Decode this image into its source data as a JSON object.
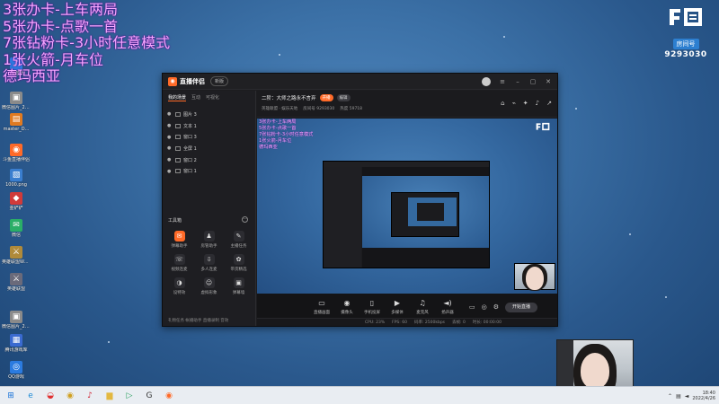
{
  "overlay": {
    "lines": [
      "3张办卡-上车两局",
      "5张办卡-点歌一首",
      "7张钻粉卡-3小时任意模式",
      "1张火箭-月车位",
      "德玛西亚"
    ]
  },
  "douyu": {
    "room_label": "房间号",
    "room_id": "9293030"
  },
  "desktop_icons": [
    {
      "label": "QQ音乐",
      "color": "#2b7be0",
      "glyph": "♪"
    },
    {
      "label": "微信图片_20220412...",
      "color": "#8a8a8a",
      "glyph": "▣"
    },
    {
      "label": "master_D...",
      "color": "#e07a20",
      "glyph": "▤"
    },
    {
      "label": "斗鱼直播伴侣",
      "color": "#ff6a28",
      "glyph": "◉"
    },
    {
      "label": "1000.png",
      "color": "#3a7ecf",
      "glyph": "▧"
    },
    {
      "label": "金铲铲",
      "color": "#d03a3a",
      "glyph": "◆"
    },
    {
      "label": "微信",
      "color": "#2aae67",
      "glyph": "✉"
    },
    {
      "label": "英雄联盟WeGame版",
      "color": "#b08a3a",
      "glyph": "⚔"
    },
    {
      "label": "英雄联盟",
      "color": "#6a6a7a",
      "glyph": "⚔"
    },
    {
      "label": "微信图片_20220413...",
      "color": "#8a8a8a",
      "glyph": "▣"
    },
    {
      "label": "腾讯游戏库",
      "color": "#3a6ad0",
      "glyph": "▦"
    },
    {
      "label": "QQ游戏",
      "color": "#2b7be0",
      "glyph": "◎"
    }
  ],
  "app": {
    "brand": "直播伴侣",
    "version": "新版",
    "sidebar_tabs": [
      "我的场景",
      "互动",
      "可视化"
    ],
    "scenes": [
      {
        "label": "图片 3"
      },
      {
        "label": "文本 1"
      },
      {
        "label": "窗口 3"
      },
      {
        "label": "全屏 1"
      },
      {
        "label": "窗口 2"
      },
      {
        "label": "窗口 1"
      }
    ],
    "tools_title": "工具箱",
    "tools": [
      {
        "label": "弹幕助手",
        "glyph": "✉",
        "hot": true
      },
      {
        "label": "房管助手",
        "glyph": "♟",
        "hot": false
      },
      {
        "label": "主播任务",
        "glyph": "✎",
        "hot": false
      },
      {
        "label": "视频连麦",
        "glyph": "☏",
        "hot": false
      },
      {
        "label": "多人连麦",
        "glyph": "⇩",
        "hot": false
      },
      {
        "label": "带货精选",
        "glyph": "✿",
        "hot": false
      },
      {
        "label": "设特效",
        "glyph": "◑",
        "hot": false
      },
      {
        "label": "虚拟形象",
        "glyph": "☺",
        "hot": false
      },
      {
        "label": "弹幕墙",
        "glyph": "▣",
        "hot": false
      }
    ],
    "status_left": "礼物任务   帐播助手    直播录制    音效",
    "room_title": "二阶：大师之路永不言弃",
    "pill_orange": "开播",
    "pill_gray": "编辑",
    "sub_info": [
      "英雄联盟 · 娱乐天地",
      "房间号 9293030",
      "热度 59718"
    ],
    "preview_lines": [
      "3张办卡-上车两局",
      "5张办卡-点歌一首",
      "7张钻粉卡-3小时任意模式",
      "1张火箭-月车位",
      "德玛西亚"
    ],
    "controls": [
      {
        "label": "直播画面",
        "glyph": "▭"
      },
      {
        "label": "摄像头",
        "glyph": "◉"
      },
      {
        "label": "手机投屏",
        "glyph": "▯"
      },
      {
        "label": "多媒体",
        "glyph": "▶"
      },
      {
        "label": "麦克风",
        "glyph": "♫"
      },
      {
        "label": "扬声器",
        "glyph": "◄)"
      }
    ],
    "go_live": "开始直播",
    "statusbar": [
      "CPU: 23%",
      "FPS: 60",
      "码率: 2500kbps",
      "丢帧: 0",
      "时长: 00:00:00"
    ]
  },
  "taskbar": {
    "apps": [
      {
        "name": "windows",
        "glyph": "⊞",
        "color": "#1a73d8"
      },
      {
        "name": "edge",
        "glyph": "e",
        "color": "#1f8bd6"
      },
      {
        "name": "qq",
        "glyph": "◒",
        "color": "#e03030"
      },
      {
        "name": "game",
        "glyph": "◉",
        "color": "#d0a020"
      },
      {
        "name": "netease",
        "glyph": "♪",
        "color": "#d02030"
      },
      {
        "name": "folder",
        "glyph": "▆",
        "color": "#e3b840"
      },
      {
        "name": "store",
        "glyph": "▷",
        "color": "#2aa060"
      },
      {
        "name": "g-app",
        "glyph": "G",
        "color": "#333"
      },
      {
        "name": "douyu",
        "glyph": "◉",
        "color": "#ff6a28"
      }
    ],
    "time": "18:40",
    "date": "2022/4/26"
  }
}
